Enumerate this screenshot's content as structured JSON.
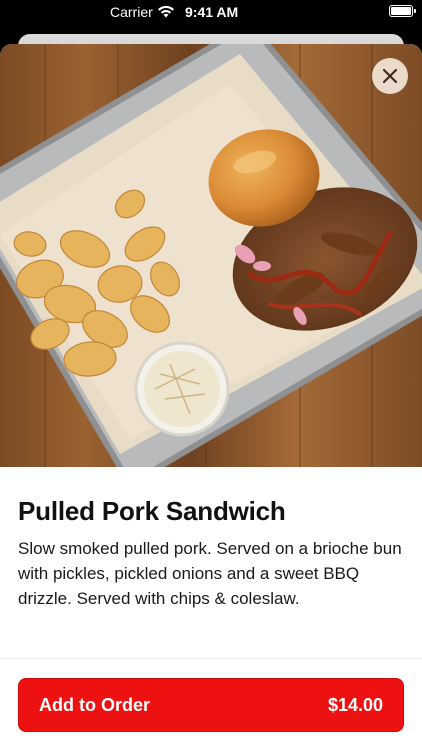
{
  "status_bar": {
    "carrier": "Carrier",
    "time": "9:41 AM",
    "icons": [
      "wifi-icon",
      "battery-icon"
    ]
  },
  "item": {
    "image_description_icon": "food-photo",
    "title": "Pulled Pork Sandwich",
    "description": "Slow smoked pulled pork. Served on a brioche bun with pickles, pickled onions and a sweet BBQ drizzle. Served with chips & coleslaw."
  },
  "close_button": {
    "icon": "close-icon"
  },
  "order_button": {
    "label": "Add to Order",
    "price": "$14.00"
  },
  "colors": {
    "accent": "#ee1111",
    "background": "#ffffff",
    "text": "#111111"
  }
}
